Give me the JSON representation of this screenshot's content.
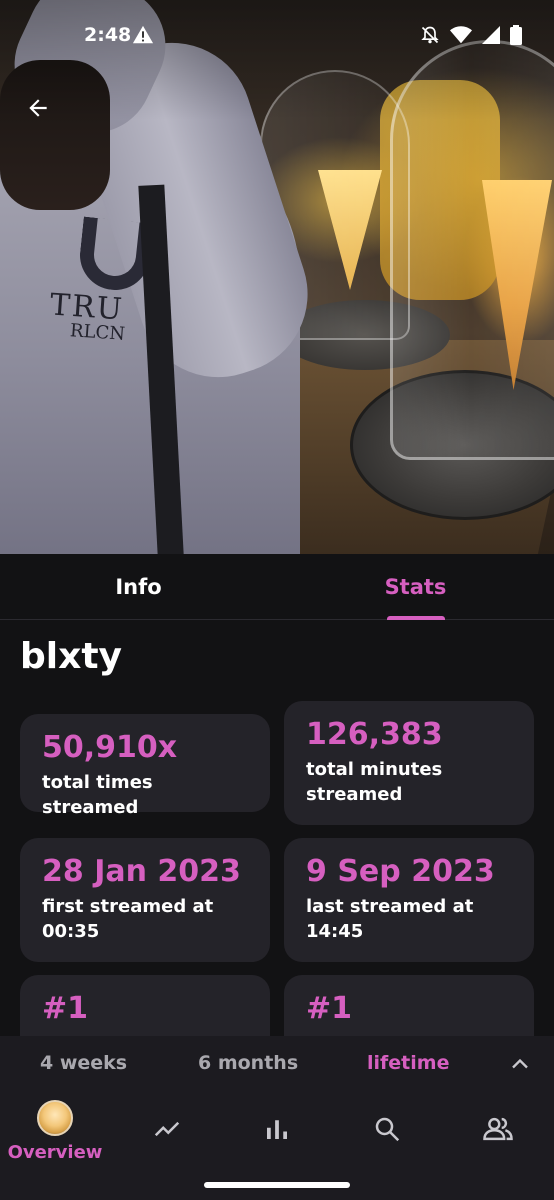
{
  "status_bar": {
    "time": "2:48",
    "icons": [
      "alert-icon",
      "silent-icon",
      "wifi-icon",
      "signal-icon",
      "battery-icon"
    ]
  },
  "hero": {
    "shirt_text_line1": "TRU",
    "shirt_text_line2": "RLCN"
  },
  "tabs": [
    {
      "label": "Info",
      "active": false
    },
    {
      "label": "Stats",
      "active": true
    }
  ],
  "page_title": "blxty",
  "stats": [
    {
      "value": "50,910x",
      "label": "total times streamed"
    },
    {
      "value": "126,383",
      "label": "total minutes streamed"
    },
    {
      "value": "28 Jan 2023",
      "label": "first streamed at 00:35"
    },
    {
      "value": "9 Sep 2023",
      "label": "last streamed at 14:45"
    },
    {
      "value": "#1",
      "label": ""
    },
    {
      "value": "#1",
      "label": ""
    }
  ],
  "time_range": {
    "options": [
      "4 weeks",
      "6 months",
      "lifetime"
    ],
    "selected": "lifetime"
  },
  "bottom_nav": {
    "items": [
      {
        "label": "Overview",
        "icon": "avatar",
        "active": true
      },
      {
        "label": "",
        "icon": "trending-icon",
        "active": false
      },
      {
        "label": "",
        "icon": "bar-chart-icon",
        "active": false
      },
      {
        "label": "",
        "icon": "search-icon",
        "active": false
      },
      {
        "label": "",
        "icon": "friends-icon",
        "active": false
      }
    ]
  },
  "colors": {
    "accent": "#d65fc0",
    "background": "#121214",
    "card": "#242329",
    "muted_text": "#a9a8ae"
  }
}
